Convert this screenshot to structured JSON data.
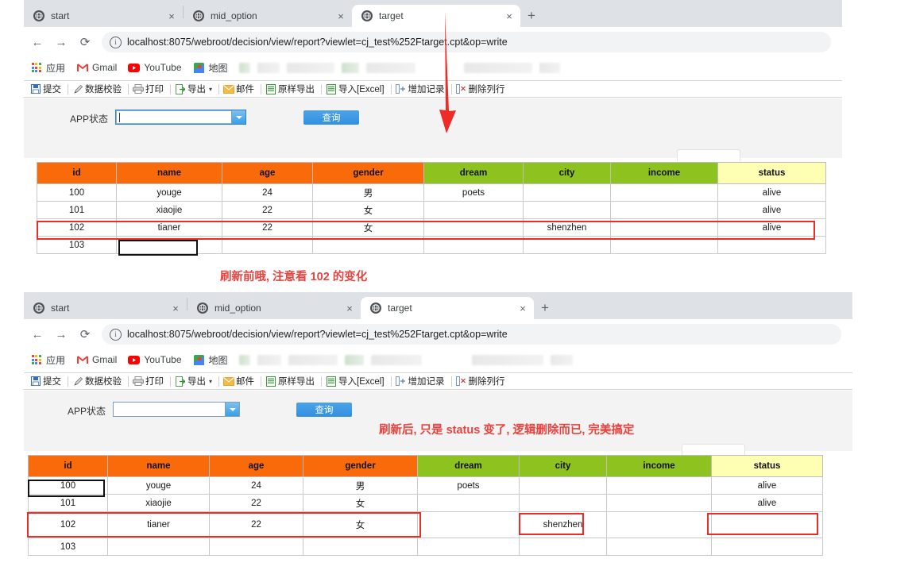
{
  "windows": [
    {
      "id": "window-top",
      "tabs": [
        {
          "label": "start",
          "active": false
        },
        {
          "label": "mid_option",
          "active": false
        },
        {
          "label": "target",
          "active": true
        }
      ],
      "newtab_label": "+",
      "close_label": "×",
      "nav": {
        "back": "←",
        "forward": "→",
        "reload": "⟳"
      },
      "url": "localhost:8075/webroot/decision/view/report?viewlet=cj_test%252Ftarget.cpt&op=write",
      "info_icon_label": "i",
      "bookmarks": [
        {
          "label": "应用",
          "icon": "apps-grid-icon"
        },
        {
          "label": "Gmail",
          "icon": "gmail-icon"
        },
        {
          "label": "YouTube",
          "icon": "youtube-icon"
        },
        {
          "label": "地图",
          "icon": "maps-icon"
        }
      ],
      "toolbar": [
        {
          "label": "提交",
          "icon": "save-icon"
        },
        {
          "label": "数据校验",
          "icon": "pencil-icon"
        },
        {
          "label": "打印",
          "icon": "printer-icon"
        },
        {
          "label": "导出",
          "icon": "export-doc-icon",
          "caret": "▾"
        },
        {
          "label": "邮件",
          "icon": "mail-icon"
        },
        {
          "label": "原样导出",
          "icon": "excel-doc-icon"
        },
        {
          "label": "导入[Excel]",
          "icon": "excel-import-icon"
        },
        {
          "label": "增加记录",
          "icon": "add-row-icon"
        },
        {
          "label": "删除列行",
          "icon": "delete-row-icon"
        }
      ],
      "query": {
        "label": "APP状态",
        "value": "",
        "placeholder": "",
        "focused": true,
        "button_label": "查询"
      },
      "table": {
        "headers": [
          {
            "label": "id",
            "color": "orange"
          },
          {
            "label": "name",
            "color": "orange"
          },
          {
            "label": "age",
            "color": "orange"
          },
          {
            "label": "gender",
            "color": "orange"
          },
          {
            "label": "dream",
            "color": "green"
          },
          {
            "label": "city",
            "color": "green"
          },
          {
            "label": "income",
            "color": "green"
          },
          {
            "label": "status",
            "color": "yellow"
          }
        ],
        "rows": [
          [
            "100",
            "youge",
            "24",
            "男",
            "poets",
            "",
            "",
            "alive"
          ],
          [
            "101",
            "xiaojie",
            "22",
            "女",
            "",
            "",
            "",
            "alive"
          ],
          [
            "102",
            "tianer",
            "22",
            "女",
            "",
            "shenzhen",
            "",
            "alive"
          ],
          [
            "103",
            "",
            "",
            "",
            "",
            "",
            "",
            ""
          ]
        ]
      },
      "annotation": "刷新前哦, 注意看 102 的变化"
    },
    {
      "id": "window-bottom",
      "tabs": [
        {
          "label": "start",
          "active": false
        },
        {
          "label": "mid_option",
          "active": false
        },
        {
          "label": "target",
          "active": true
        }
      ],
      "newtab_label": "+",
      "close_label": "×",
      "nav": {
        "back": "←",
        "forward": "→",
        "reload": "⟳"
      },
      "url": "localhost:8075/webroot/decision/view/report?viewlet=cj_test%252Ftarget.cpt&op=write",
      "info_icon_label": "i",
      "bookmarks": [
        {
          "label": "应用",
          "icon": "apps-grid-icon"
        },
        {
          "label": "Gmail",
          "icon": "gmail-icon"
        },
        {
          "label": "YouTube",
          "icon": "youtube-icon"
        },
        {
          "label": "地图",
          "icon": "maps-icon"
        }
      ],
      "toolbar": [
        {
          "label": "提交",
          "icon": "save-icon"
        },
        {
          "label": "数据校验",
          "icon": "pencil-icon"
        },
        {
          "label": "打印",
          "icon": "printer-icon"
        },
        {
          "label": "导出",
          "icon": "export-doc-icon",
          "caret": "▾"
        },
        {
          "label": "邮件",
          "icon": "mail-icon"
        },
        {
          "label": "原样导出",
          "icon": "excel-doc-icon"
        },
        {
          "label": "导入[Excel]",
          "icon": "excel-import-icon"
        },
        {
          "label": "增加记录",
          "icon": "add-row-icon"
        },
        {
          "label": "删除列行",
          "icon": "delete-row-icon"
        }
      ],
      "query": {
        "label": "APP状态",
        "value": "",
        "placeholder": "",
        "focused": false,
        "button_label": "查询"
      },
      "table": {
        "headers": [
          {
            "label": "id",
            "color": "orange"
          },
          {
            "label": "name",
            "color": "orange"
          },
          {
            "label": "age",
            "color": "orange"
          },
          {
            "label": "gender",
            "color": "orange"
          },
          {
            "label": "dream",
            "color": "green"
          },
          {
            "label": "city",
            "color": "green"
          },
          {
            "label": "income",
            "color": "green"
          },
          {
            "label": "status",
            "color": "yellow"
          }
        ],
        "rows": [
          [
            "100",
            "youge",
            "24",
            "男",
            "poets",
            "",
            "",
            "alive"
          ],
          [
            "101",
            "xiaojie",
            "22",
            "女",
            "",
            "",
            "",
            "alive"
          ],
          [
            "102",
            "tianer",
            "22",
            "女",
            "",
            "shenzhen",
            "",
            ""
          ],
          [
            "103",
            "",
            "",
            "",
            "",
            "",
            "",
            ""
          ]
        ]
      },
      "annotation": "刷新后, 只是 status 变了, 逻辑删除而已, 完美搞定"
    }
  ],
  "colors": {
    "header_orange": "#f96a0b",
    "header_green": "#8dc21f",
    "header_yellow": "#ffffb3",
    "annotation_red": "#e8433f",
    "highlight_box_red": "#ee2b26",
    "query_button_blue": "#3191e0",
    "selection_black": "#111111"
  }
}
